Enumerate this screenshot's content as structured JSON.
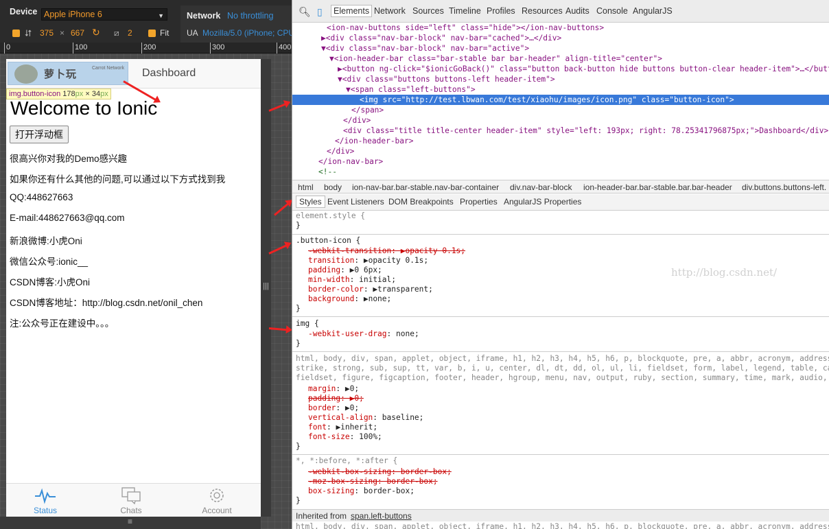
{
  "emulator": {
    "device_label": "Device",
    "device_value": "Apple iPhone 6",
    "network_label": "Network",
    "network_value": "No throttling",
    "width": "375",
    "times": "×",
    "height": "667",
    "zoom": "2",
    "fit_label": "Fit",
    "ua_label": "UA",
    "ua_value": "Mozilla/5.0 (iPhone; CPU",
    "ruler": [
      "0",
      "100",
      "200",
      "300",
      "400"
    ]
  },
  "app": {
    "logo_text": "萝卜玩",
    "logo_en": "Carrot Network",
    "header_title": "Dashboard",
    "tooltip_selector": "img.button-icon",
    "tooltip_w": "178",
    "tooltip_h": "34",
    "px": "px",
    "x": "×",
    "welcome": "Welcome to Ionic",
    "open_button": "打开浮动框",
    "paragraphs": [
      "很高兴你对我的Demo感兴趣",
      "如果你还有什么其他的问题,可以通过以下方式找到我",
      "QQ:448627663",
      "E-mail:448627663@qq.com",
      "新浪微博:小虎Oni",
      "微信公众号:ionic__",
      "CSDN博客:小虎Oni",
      "CSDN博客地址：http://blog.csdn.net/onil_chen",
      "注:公众号正在建设中。。。"
    ],
    "tabs": [
      {
        "label": "Status",
        "icon": "pulse-icon"
      },
      {
        "label": "Chats",
        "icon": "chat-bubbles-icon"
      },
      {
        "label": "Account",
        "icon": "gear-icon"
      }
    ],
    "accent": "#3a8fd8"
  },
  "devtools": {
    "tabs": [
      "Elements",
      "Network",
      "Sources",
      "Timeline",
      "Profiles",
      "Resources",
      "Audits",
      "Console",
      "AngularJS"
    ],
    "tree": [
      "<ion-nav-buttons side=\"left\" class=\"hide\"></ion-nav-buttons>",
      "▶<div class=\"nav-bar-block\" nav-bar=\"cached\">…</div>",
      "▼<div class=\"nav-bar-block\" nav-bar=\"active\">",
      "▼<ion-header-bar class=\"bar-stable bar bar-header\" align-title=\"center\">",
      "▶<button ng-click=\"$ionicGoBack()\" class=\"button back-button hide buttons  button-clear header-item\">…</button>",
      "▼<div class=\"buttons buttons-left header-item\">",
      "▼<span class=\"left-buttons\">",
      "<img src=\"http://test.lbwan.com/test/xiaohu/images/icon.png\" class=\"button-icon\">",
      "</span>",
      "</div>",
      "<div class=\"title title-center header-item\" style=\"left: 193px; right: 78.25341796875px;\">Dashboard</div>",
      "</ion-header-bar>",
      "</div>",
      "</ion-nav-bar>",
      "<!--"
    ],
    "breadcrumbs": [
      "html",
      "body",
      "ion-nav-bar.bar-stable.nav-bar-container",
      "div.nav-bar-block",
      "ion-header-bar.bar-stable.bar.bar-header",
      "div.buttons.buttons-left."
    ],
    "subtabs": [
      "Styles",
      "Event Listeners",
      "DOM Breakpoints",
      "Properties",
      "AngularJS Properties"
    ],
    "styles": {
      "element_style": "element.style {",
      "close": "}",
      "button_icon_sel": ".button-icon {",
      "bi_props": [
        [
          "-webkit-transition",
          "▶opacity 0.1s;",
          true
        ],
        [
          "transition",
          "▶opacity 0.1s;",
          false
        ],
        [
          "padding",
          "▶0 6px;",
          false
        ],
        [
          "min-width",
          "initial;",
          false
        ],
        [
          "border-color",
          "▶transparent;",
          false
        ],
        [
          "background",
          "▶none;",
          false
        ]
      ],
      "img_sel": "img {",
      "img_prop": [
        "-webkit-user-drag",
        "none;"
      ],
      "reset_sel_1": "html, body, div, span, applet, object, iframe, h1, h2, h3, h4, h5, h6, p, blockquote, pre, a, abbr, acronym, address,",
      "reset_sel_2": "strike, strong, sub, sup, tt, var, b, i, u, center, dl, dt, dd, ol, ul, li, fieldset, form, label, legend, table, capt",
      "reset_sel_3": "fieldset, figure, figcaption, footer, header, hgroup, menu, nav, output, ruby, section, summary, time, mark, audio, vi",
      "reset_props": [
        [
          "margin",
          "▶0;",
          false
        ],
        [
          "padding",
          "▶0;",
          true
        ],
        [
          "border",
          "▶0;",
          false
        ],
        [
          "vertical-align",
          "baseline;",
          false
        ],
        [
          "font",
          "▶inherit;",
          false
        ],
        [
          "font-size",
          "100%;",
          false
        ]
      ],
      "star_sel": "*, *:before, *:after {",
      "star_props": [
        [
          "-webkit-box-sizing",
          "border-box;",
          true
        ],
        [
          "-moz-box-sizing",
          "border-box;",
          true
        ],
        [
          "box-sizing",
          "border-box;",
          false
        ]
      ],
      "inherited_label": "Inherited from ",
      "inherited_link": "span.left-buttons",
      "last_line": "html, body, div, span, applet, object, iframe, h1, h2, h3, h4, h5, h6, p, blockquote, pre, a, abbr, acronym, address,"
    },
    "watermark": "http://blog.csdn.net/"
  }
}
